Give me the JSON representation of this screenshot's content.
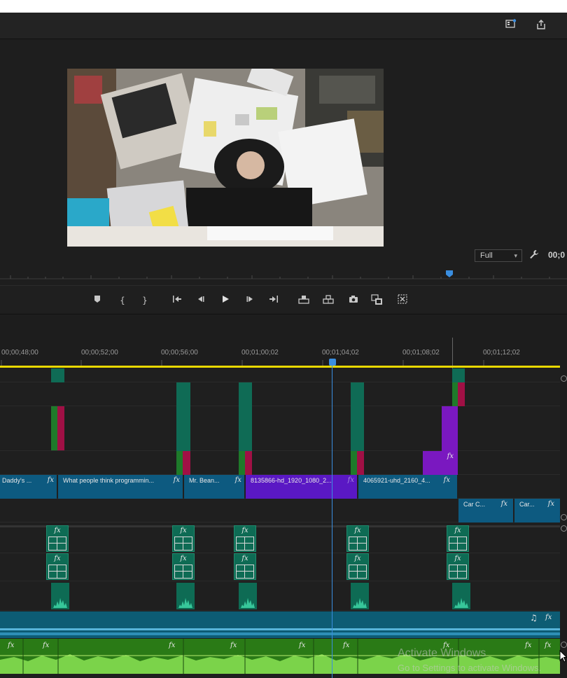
{
  "header": {
    "export_icon": "export-share-icon",
    "workspace_icon": "workspace-icon"
  },
  "program_monitor": {
    "zoom_value": "Full",
    "timecode_partial": "00;0",
    "wrench_icon": "settings-wrench-icon"
  },
  "transport": {
    "buttons": [
      {
        "name": "add-marker-button",
        "glyph": "⬟"
      },
      {
        "name": "mark-in-button",
        "glyph": "{"
      },
      {
        "name": "mark-out-button",
        "glyph": "}"
      },
      {
        "name": "go-to-in-button",
        "glyph": "⇤"
      },
      {
        "name": "step-back-button",
        "glyph": "◀"
      },
      {
        "name": "play-button",
        "glyph": "▶"
      },
      {
        "name": "step-forward-button",
        "glyph": "▶"
      },
      {
        "name": "go-to-out-button",
        "glyph": "⇥"
      },
      {
        "name": "lift-button",
        "glyph": "⏏"
      },
      {
        "name": "extract-button",
        "glyph": "⏏"
      },
      {
        "name": "export-frame-button",
        "glyph": "📷"
      },
      {
        "name": "comparison-view-button",
        "glyph": "▣"
      },
      {
        "name": "vr-video-button",
        "glyph": "⊗"
      }
    ]
  },
  "timeline": {
    "timecodes": [
      "00;00;48;00",
      "00;00;52;00",
      "00;00;56;00",
      "00;01;00;02",
      "00;01;04;02",
      "00;01;08;02",
      "00;01;12;02"
    ],
    "v_clips": [
      {
        "label": "Daddy's ...",
        "fx": "fx"
      },
      {
        "label": "What people think programmin...",
        "fx": "fx"
      },
      {
        "label": "Mr. Bean...",
        "fx": "fx"
      },
      {
        "label": "8135866-hd_1920_1080_2...",
        "fx": "fx"
      },
      {
        "label": "4065921-uhd_2160_4...",
        "fx": "fx"
      }
    ],
    "v_clips_lower": [
      {
        "label": "Car C...",
        "fx": "fx"
      },
      {
        "label": "Car...",
        "fx": "fx"
      }
    ],
    "purple_fx": "fx",
    "stack_fx": "fx",
    "music_icon": "♫",
    "music_fx": "fx",
    "green_fx": "fx"
  },
  "watermark": {
    "line1": "Activate Windows",
    "line2": "Go to Settings to activate Windows."
  },
  "colors": {
    "accent_blue": "#3a8ee0",
    "clip_blue": "#0d5a80",
    "clip_purple": "#5a18c4",
    "clip_teal": "#0f6b55",
    "audio_green": "#2a7a16",
    "work_area_yellow": "#e8d800"
  }
}
